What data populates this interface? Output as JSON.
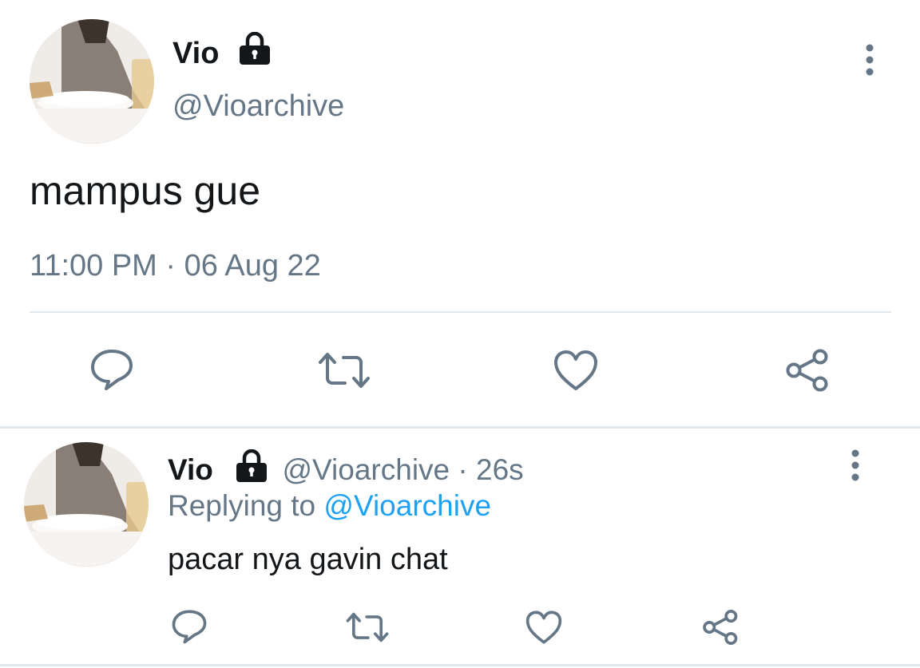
{
  "main_tweet": {
    "display_name": "Vio",
    "handle": "@Vioarchive",
    "text": "mampus gue",
    "time": "11:00 PM",
    "separator": "·",
    "date": "06 Aug 22",
    "icons": {
      "lock": "lock-icon",
      "more": "more-vertical-icon",
      "reply": "reply-icon",
      "retweet": "retweet-icon",
      "like": "heart-icon",
      "share": "share-icon"
    }
  },
  "reply_tweet": {
    "display_name": "Vio",
    "handle": "@Vioarchive",
    "separator": "·",
    "age": "26s",
    "replying_label": "Replying to",
    "replying_handle": "@Vioarchive",
    "text": "pacar nya gavin chat"
  },
  "colors": {
    "text": "#14171a",
    "secondary": "#657786",
    "accent": "#1da1f2",
    "divider": "#e1e8ed"
  }
}
